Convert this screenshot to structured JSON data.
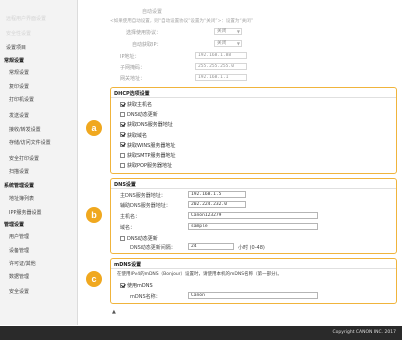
{
  "sidebar": {
    "items": [
      {
        "label": "远程用户界面设置",
        "kind": "item",
        "faded": true
      },
      {
        "label": "安全性设置",
        "kind": "item",
        "faded": true
      },
      {
        "label": "设置项目",
        "kind": "item"
      },
      {
        "label": "常规设置",
        "kind": "head"
      },
      {
        "label": "常规设置",
        "kind": "sub"
      },
      {
        "label": "复印设置",
        "kind": "sub"
      },
      {
        "label": "打印机设置",
        "kind": "sub"
      },
      {
        "label": "发送设置",
        "kind": "sub"
      },
      {
        "label": "接收/转发设置",
        "kind": "sub"
      },
      {
        "label": "存储/访问文件设置",
        "kind": "sub"
      },
      {
        "label": "安全打印设置",
        "kind": "sub"
      },
      {
        "label": "扫描设置",
        "kind": "sub"
      },
      {
        "label": "系统管理设置",
        "kind": "head"
      },
      {
        "label": "地址簿列表",
        "kind": "sub"
      },
      {
        "label": "IPP服务器设置",
        "kind": "sub"
      },
      {
        "label": "管理设置",
        "kind": "head"
      },
      {
        "label": "用户管理",
        "kind": "sub"
      },
      {
        "label": "设备管理",
        "kind": "sub"
      },
      {
        "label": "许可证/其他",
        "kind": "sub"
      },
      {
        "label": "数据管理",
        "kind": "sub"
      },
      {
        "label": "安全设置",
        "kind": "sub"
      }
    ]
  },
  "top": {
    "heading": "自动设置",
    "note": "<如果使用自动设置，则“自动设置协议”设置为“关闭”>：设置为“关闭”",
    "auto_protocol_label": "选择使用协议：",
    "auto_protocol_value": "关闭",
    "auto_ip_label": "自动获取IP：",
    "auto_ip_value": "关闭",
    "ip_label": "IP地址：",
    "ip_value": "192.168.1.88",
    "mask_label": "子网掩码：",
    "mask_value": "255.255.255.0",
    "gateway_label": "网关地址：",
    "gateway_value": "192.168.1.1"
  },
  "dhcp": {
    "title": "DHCP选项设置",
    "options": [
      {
        "label": "获取主机名",
        "checked": true
      },
      {
        "label": "DNS动态更新",
        "checked": false
      },
      {
        "label": "获取DNS服务器地址",
        "checked": true
      },
      {
        "label": "获取域名",
        "checked": true
      },
      {
        "label": "获取WINS服务器地址",
        "checked": true
      },
      {
        "label": "获取SMTP服务器地址",
        "checked": false
      },
      {
        "label": "获取POP服务器地址",
        "checked": false
      }
    ]
  },
  "dns": {
    "title": "DNS设置",
    "primary_label": "主DNS服务器地址：",
    "primary_value": "192.168.1.5",
    "secondary_label": "辅助DNS服务器地址：",
    "secondary_value": "202.224.232.0",
    "host_label": "主机名：",
    "host_value": "Canon123279",
    "domain_label": "域名：",
    "domain_value": "sample",
    "dynamic_label": "DNS动态更新",
    "interval_label": "DNS动态更新间隔：",
    "interval_value": "24",
    "interval_unit": "小时 (0-48)"
  },
  "mdns": {
    "title": "mDNS设置",
    "note": "在使用IPv4的mDNS（Bonjour）设置时，请使用本机的mDNS名称（第一部分)。",
    "use_label": "使用mDNS",
    "name_label": "mDNS名称：",
    "name_value": "Canon"
  },
  "badges": [
    "a",
    "b",
    "c"
  ],
  "footer": {
    "copyright": "Copyright CANON INC. 2017"
  },
  "colors": {
    "accent": "#f0a81f",
    "border": "#f0b43c",
    "footer": "#2a2a2a"
  }
}
